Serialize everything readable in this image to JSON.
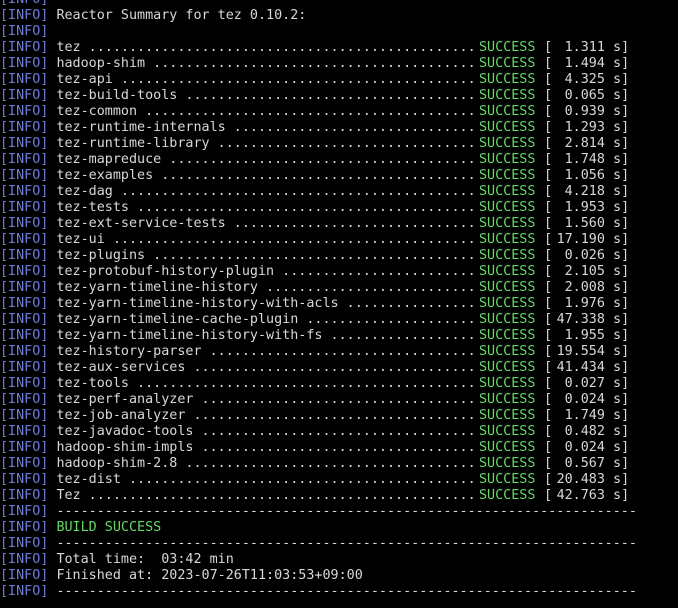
{
  "tag": "[INFO]",
  "rule": "------------------------------------------------------------------------",
  "header": "Reactor Summary for tez 0.10.2:",
  "modules": [
    {
      "name": "tez",
      "status": "SUCCESS",
      "time": "1.311 s"
    },
    {
      "name": "hadoop-shim",
      "status": "SUCCESS",
      "time": "1.494 s"
    },
    {
      "name": "tez-api",
      "status": "SUCCESS",
      "time": "4.325 s"
    },
    {
      "name": "tez-build-tools",
      "status": "SUCCESS",
      "time": "0.065 s"
    },
    {
      "name": "tez-common",
      "status": "SUCCESS",
      "time": "0.939 s"
    },
    {
      "name": "tez-runtime-internals",
      "status": "SUCCESS",
      "time": "1.293 s"
    },
    {
      "name": "tez-runtime-library",
      "status": "SUCCESS",
      "time": "2.814 s"
    },
    {
      "name": "tez-mapreduce",
      "status": "SUCCESS",
      "time": "1.748 s"
    },
    {
      "name": "tez-examples",
      "status": "SUCCESS",
      "time": "1.056 s"
    },
    {
      "name": "tez-dag",
      "status": "SUCCESS",
      "time": "4.218 s"
    },
    {
      "name": "tez-tests",
      "status": "SUCCESS",
      "time": "1.953 s"
    },
    {
      "name": "tez-ext-service-tests",
      "status": "SUCCESS",
      "time": "1.560 s"
    },
    {
      "name": "tez-ui",
      "status": "SUCCESS",
      "time": "17.190 s"
    },
    {
      "name": "tez-plugins",
      "status": "SUCCESS",
      "time": "0.026 s"
    },
    {
      "name": "tez-protobuf-history-plugin",
      "status": "SUCCESS",
      "time": "2.105 s"
    },
    {
      "name": "tez-yarn-timeline-history",
      "status": "SUCCESS",
      "time": "2.008 s"
    },
    {
      "name": "tez-yarn-timeline-history-with-acls",
      "status": "SUCCESS",
      "time": "1.976 s"
    },
    {
      "name": "tez-yarn-timeline-cache-plugin",
      "status": "SUCCESS",
      "time": "47.338 s"
    },
    {
      "name": "tez-yarn-timeline-history-with-fs",
      "status": "SUCCESS",
      "time": "1.955 s"
    },
    {
      "name": "tez-history-parser",
      "status": "SUCCESS",
      "time": "19.554 s"
    },
    {
      "name": "tez-aux-services",
      "status": "SUCCESS",
      "time": "41.434 s"
    },
    {
      "name": "tez-tools",
      "status": "SUCCESS",
      "time": "0.027 s"
    },
    {
      "name": "tez-perf-analyzer",
      "status": "SUCCESS",
      "time": "0.024 s"
    },
    {
      "name": "tez-job-analyzer",
      "status": "SUCCESS",
      "time": "1.749 s"
    },
    {
      "name": "tez-javadoc-tools",
      "status": "SUCCESS",
      "time": "0.482 s"
    },
    {
      "name": "hadoop-shim-impls",
      "status": "SUCCESS",
      "time": "0.024 s"
    },
    {
      "name": "hadoop-shim-2.8",
      "status": "SUCCESS",
      "time": "0.567 s"
    },
    {
      "name": "tez-dist",
      "status": "SUCCESS",
      "time": "20.483 s"
    },
    {
      "name": "Tez",
      "status": "SUCCESS",
      "time": "42.763 s"
    }
  ],
  "build_result": "BUILD SUCCESS",
  "total_time": "Total time:  03:42 min",
  "finished_at": "Finished at: 2023-07-26T11:03:53+09:00",
  "colors": {
    "tag": "#6f7bd8",
    "success": "#64d964",
    "text": "#d8d8d8",
    "background": "#000000"
  }
}
